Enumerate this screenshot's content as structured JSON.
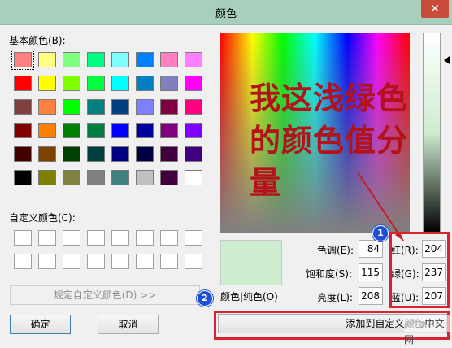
{
  "window": {
    "title": "颜色",
    "close_glyph": "✕"
  },
  "basic_colors": {
    "label": "基本颜色(B):",
    "selected_index": 0,
    "swatches": [
      "#ff8080",
      "#ffff80",
      "#80ff80",
      "#00ff80",
      "#80ffff",
      "#0080ff",
      "#ff80c0",
      "#ff80ff",
      "#ff0000",
      "#ffff00",
      "#80ff00",
      "#00ff40",
      "#00ffff",
      "#0080c0",
      "#8080c0",
      "#ff00ff",
      "#804040",
      "#ff8040",
      "#00ff00",
      "#008080",
      "#004080",
      "#8080ff",
      "#800040",
      "#ff0080",
      "#800000",
      "#ff8000",
      "#008000",
      "#008040",
      "#0000ff",
      "#0000a0",
      "#800080",
      "#8000ff",
      "#400000",
      "#804000",
      "#004000",
      "#004040",
      "#000080",
      "#000040",
      "#400040",
      "#400080",
      "#000000",
      "#808000",
      "#808040",
      "#808080",
      "#408080",
      "#c0c0c0",
      "#400040",
      "#ffffff"
    ]
  },
  "custom_colors": {
    "label": "自定义颜色(C):",
    "count": 16
  },
  "buttons": {
    "define_custom": "规定自定义颜色(D) >>",
    "ok": "确定",
    "cancel": "取消",
    "add_to_custom": "添加到自定义颜色(A)"
  },
  "color_solid_label": "颜色|纯色(O)",
  "fields": {
    "hue": {
      "label": "色调(E):",
      "value": "84"
    },
    "sat": {
      "label": "饱和度(S):",
      "value": "115"
    },
    "lum": {
      "label": "亮度(L):",
      "value": "208"
    },
    "red": {
      "label": "红(R):",
      "value": "204"
    },
    "green": {
      "label": "绿(G):",
      "value": "237"
    },
    "blue": {
      "label": "蓝(U):",
      "value": "207"
    }
  },
  "current_color": "#cdecd0",
  "annotation": {
    "text": "我这浅绿色的颜色值分量",
    "color": "#b3121a",
    "badge1": "1",
    "badge2": "2"
  },
  "watermark": {
    "brand": "php",
    "text": "中文网"
  }
}
